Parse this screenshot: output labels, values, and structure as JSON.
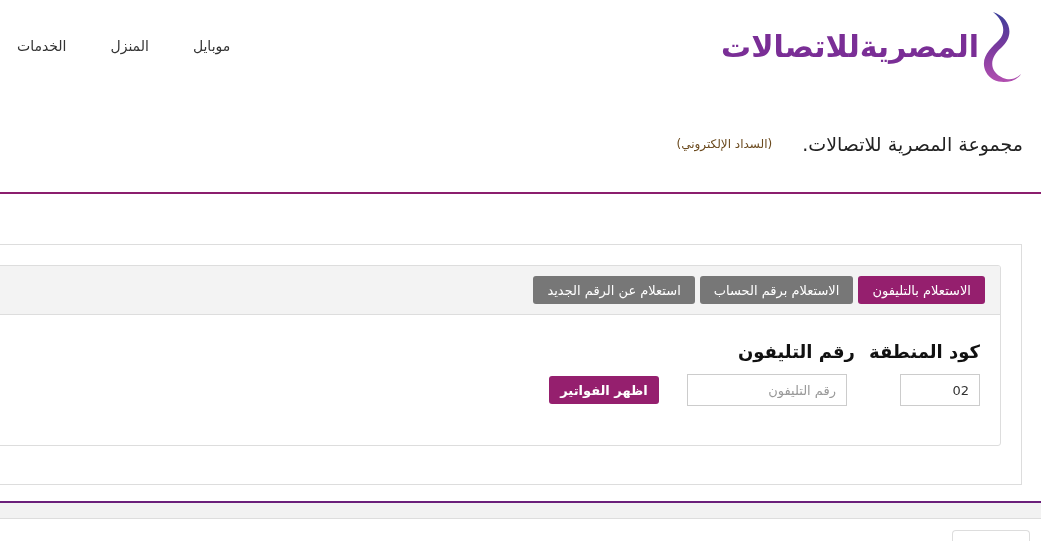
{
  "header": {
    "logo_text": "المصريةللاتصالات",
    "nav": [
      {
        "label": "موبايل"
      },
      {
        "label": "المنزل"
      },
      {
        "label": "الخدمات"
      }
    ]
  },
  "page_title": {
    "title": "مجموعة المصرية للاتصالات.",
    "subtitle": "(السداد الإلكتروني)"
  },
  "tabs": [
    {
      "label": "الاستعلام بالتليفون",
      "selected": true
    },
    {
      "label": "الاستعلام برقم الحساب",
      "selected": false
    },
    {
      "label": "استعلام عن الرقم الجديد",
      "selected": false
    }
  ],
  "form": {
    "area_code_label": "كود المنطقة",
    "phone_label": "رقم التليفون",
    "area_code_value": "02",
    "phone_placeholder": "رقم التليفون",
    "submit": "اظهر الفواتير"
  }
}
